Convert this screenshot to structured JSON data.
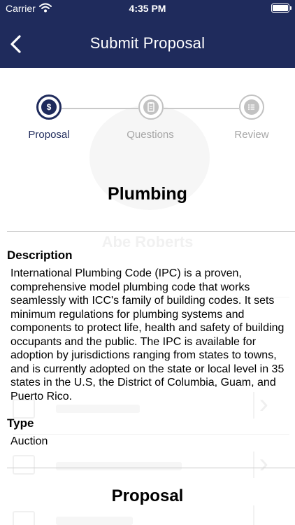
{
  "status_bar": {
    "carrier": "Carrier",
    "time": "4:35 PM",
    "wifi_icon": "wifi-icon",
    "battery_icon": "battery-icon"
  },
  "nav": {
    "title": "Submit Proposal",
    "back_icon": "chevron-left-icon"
  },
  "stepper": {
    "steps": [
      {
        "label": "Proposal",
        "icon": "dollar-icon",
        "state": "active"
      },
      {
        "label": "Questions",
        "icon": "clipboard-icon",
        "state": "inactive"
      },
      {
        "label": "Review",
        "icon": "list-icon",
        "state": "inactive"
      }
    ],
    "active_color": "#1f2b5c",
    "inactive_color": "#c2c2c2"
  },
  "content": {
    "subject_title": "Plumbing",
    "description_heading": "Description",
    "description_text": "International Plumbing Code (IPC) is a proven, comprehensive model plumbing code that works seamlessly with ICC's family of building codes. It sets minimum regulations for plumbing systems and components to protect life, health and safety of building occupants and the public. The IPC is available for adoption by jurisdictions ranging from states to towns, and is currently adopted on the state or local level in 35 states in the U.S, the District of Columbia, Guam, and Puerto Rico.",
    "type_heading": "Type",
    "type_value": "Auction",
    "proposal_heading": "Proposal"
  },
  "background_ghost": {
    "name": "Abe Roberts"
  },
  "colors": {
    "header": "#1f2b5c",
    "divider": "#c8c8c8"
  }
}
